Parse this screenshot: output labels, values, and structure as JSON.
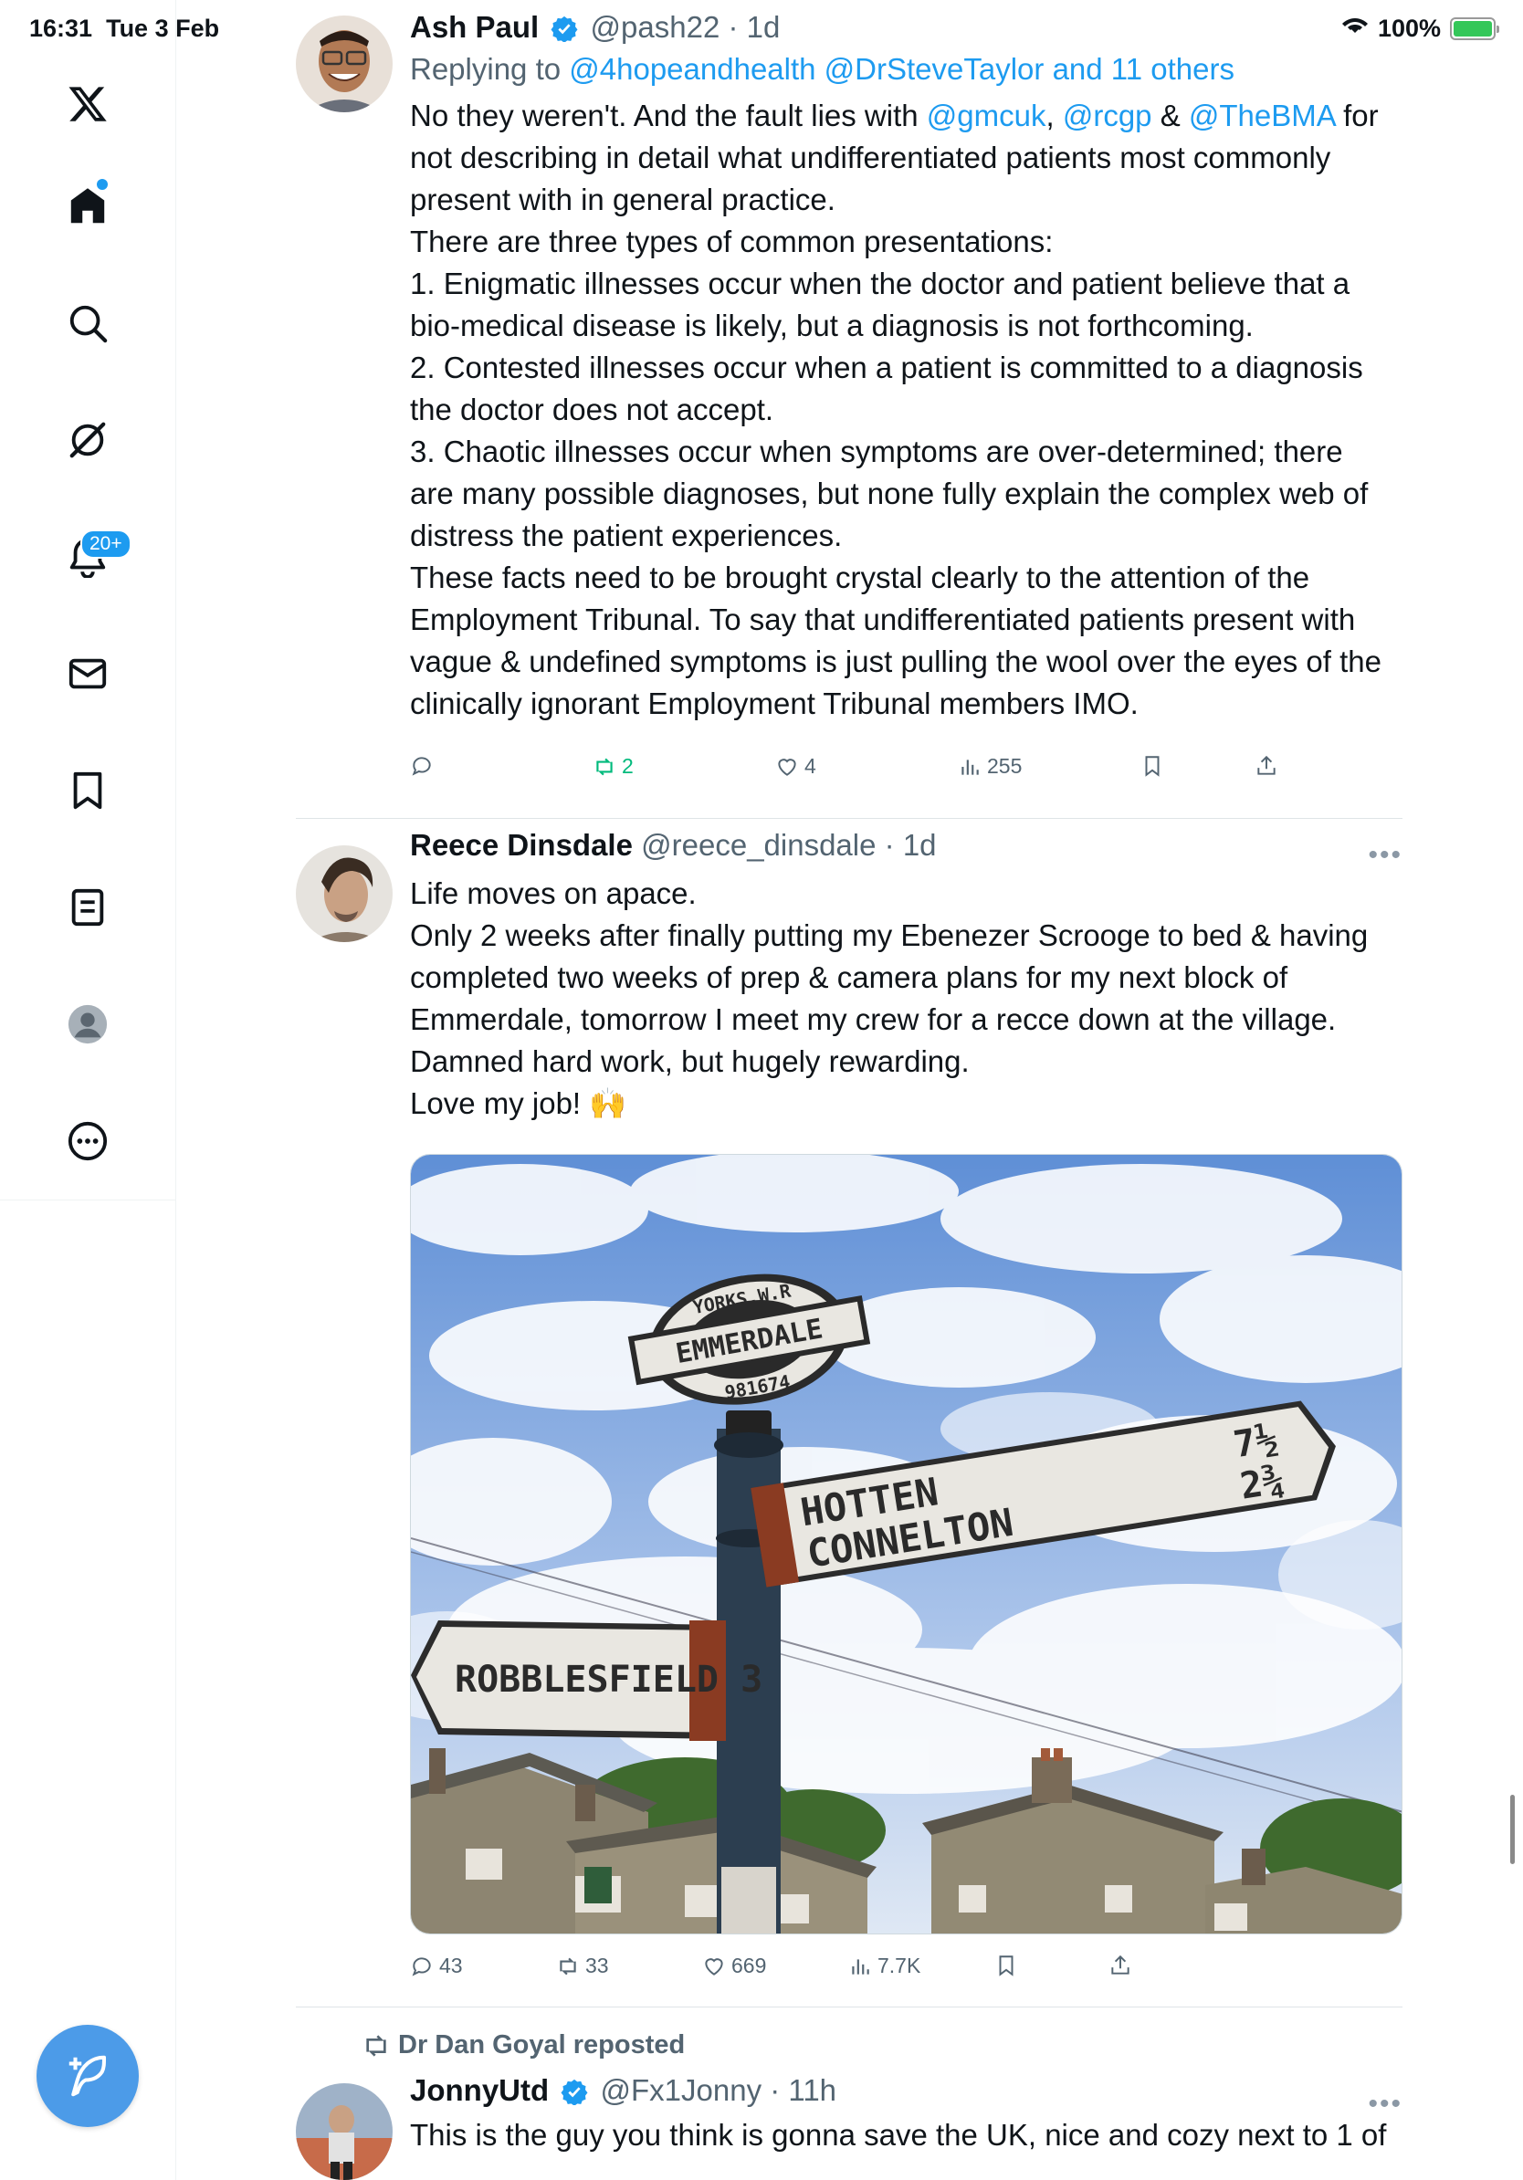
{
  "status": {
    "time": "16:31",
    "date": "Tue 3 Feb",
    "battery": "100%",
    "icons": [
      "wifi-icon",
      "battery-charging-icon"
    ]
  },
  "sidebar": {
    "items": [
      {
        "name": "x-logo",
        "icon": "x-logo-icon"
      },
      {
        "name": "home",
        "icon": "home-icon"
      },
      {
        "name": "explore",
        "icon": "search-icon"
      },
      {
        "name": "grok",
        "icon": "grok-icon"
      },
      {
        "name": "notifications",
        "icon": "bell-icon",
        "badge": "20+"
      },
      {
        "name": "messages",
        "icon": "envelope-icon"
      },
      {
        "name": "bookmarks",
        "icon": "bookmark-icon"
      },
      {
        "name": "lists",
        "icon": "list-icon"
      },
      {
        "name": "profile",
        "icon": "profile-icon"
      },
      {
        "name": "more",
        "icon": "more-circle-icon"
      }
    ],
    "compose_icon": "compose-feather-icon"
  },
  "tweets": [
    {
      "name": "Ash Paul",
      "handle": "@pash22",
      "time": "1d",
      "verified": true,
      "replying_prefix": "Replying to ",
      "replying_to": "@4hopeandhealth @DrSteveTaylor and 11 others",
      "text_1": "No they weren't. And the fault lies with ",
      "mention_1": "@gmcuk",
      "sep_1": ", ",
      "mention_2": "@rcgp",
      "sep_2": " & ",
      "mention_3": "@TheBMA",
      "text_2": " for not describing in detail what undifferentiated patients most commonly present with in general practice.\nThere are three types of common presentations:\n1. Enigmatic illnesses occur when the doctor and patient believe that a bio-medical disease is likely, but a diagnosis is not forthcoming.\n2. Contested illnesses occur when a patient is committed to a diagnosis the doctor does not accept.\n3. Chaotic illnesses occur when symptoms are over-determined; there are many possible diagnoses, but none fully explain the complex web of distress the patient experiences.\nThese facts need to be brought crystal clearly to the attention of the Employment Tribunal. To say that undifferentiated patients present with vague & undefined symptoms is just pulling the wool over the eyes of the clinically ignorant Employment Tribunal members IMO.",
      "replies": "",
      "retweets": "2",
      "likes": "4",
      "views": "255"
    },
    {
      "name": "Reece Dinsdale",
      "handle": "@reece_dinsdale",
      "time": "1d",
      "text": "Life moves on apace.\nOnly 2 weeks after finally putting my Ebenezer Scrooge to bed & having completed two weeks of prep & camera plans for my next block of Emmerdale, tomorrow I meet my crew for a recce down at the village.\nDamned hard work, but hugely rewarding.\nLove my job! 🙌",
      "image": {
        "sign_top_arc": "YORKS.W.R",
        "sign_center": "EMMERDALE",
        "sign_bottom_arc": "981674",
        "right_arm_1": "HOTTEN",
        "right_arm_1_dist": "7½",
        "right_arm_2": "CONNELTON",
        "right_arm_2_dist": "2¾",
        "left_arm": "ROBBLESFIELD 3"
      },
      "replies": "43",
      "retweets": "33",
      "likes": "669",
      "views": "7.7K"
    },
    {
      "repost_by": "Dr Dan Goyal reposted",
      "name": "JonnyUtd",
      "handle": "@Fx1Jonny",
      "time": "11h",
      "verified": true,
      "text": "This is the guy you think is gonna save the UK, nice and cozy next to 1 of"
    }
  ],
  "colors": {
    "accent": "#1d9bf0",
    "retweet_green": "#00ba7c",
    "compose_button": "#4c9be8",
    "secondary_text": "#536471"
  }
}
